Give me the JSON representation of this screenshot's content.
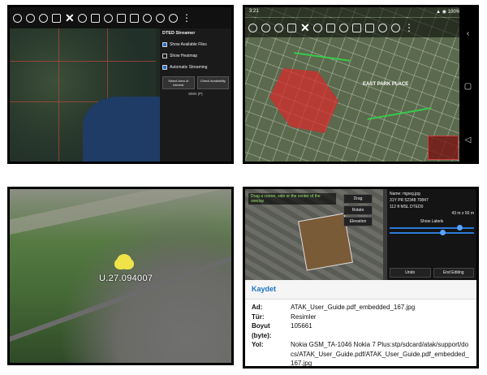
{
  "panel1": {
    "side_title": "DTED Streamer",
    "options": [
      "Show Available Files",
      "Show Heatmap",
      "Automatic Streaming"
    ],
    "buttons": [
      "Select Area of Interest",
      "Check Availability"
    ],
    "sub_label": "MSN (P)"
  },
  "panel2": {
    "status_time": "3:21",
    "status_right": "▲ ◉ 100%",
    "area_label": "EAST PARK PLACE"
  },
  "panel3": {
    "marker_label": "U.27.094007"
  },
  "panel4": {
    "tip": "Drag a corner, side or the center of the overlay",
    "buttons": [
      "Drag",
      "Rotate",
      "Elevation"
    ],
    "info": [
      "Name: mjpeg.jpg",
      "31Y PR 52348 70847",
      "112 ft MSL DTED0",
      "43 m x 50 m",
      "Show Labels"
    ],
    "undo": "Undo",
    "end_editing": "End Editing",
    "tab": "Kaydet",
    "props": [
      {
        "k": "Ad:",
        "v": "ATAK_User_Guide.pdf_embedded_167.jpg"
      },
      {
        "k": "Tür:",
        "v": "Resimler"
      },
      {
        "k": "Boyut (byte):",
        "v": "105661"
      },
      {
        "k": "Yol:",
        "v": "Nokia GSM_TA-1046 Nokia 7 Plus:stp/sdcard/atak/support/docs/ATAK_User_Guide.pdf/ATAK_User_Guide.pdf_embedded_167.jpg"
      }
    ]
  }
}
